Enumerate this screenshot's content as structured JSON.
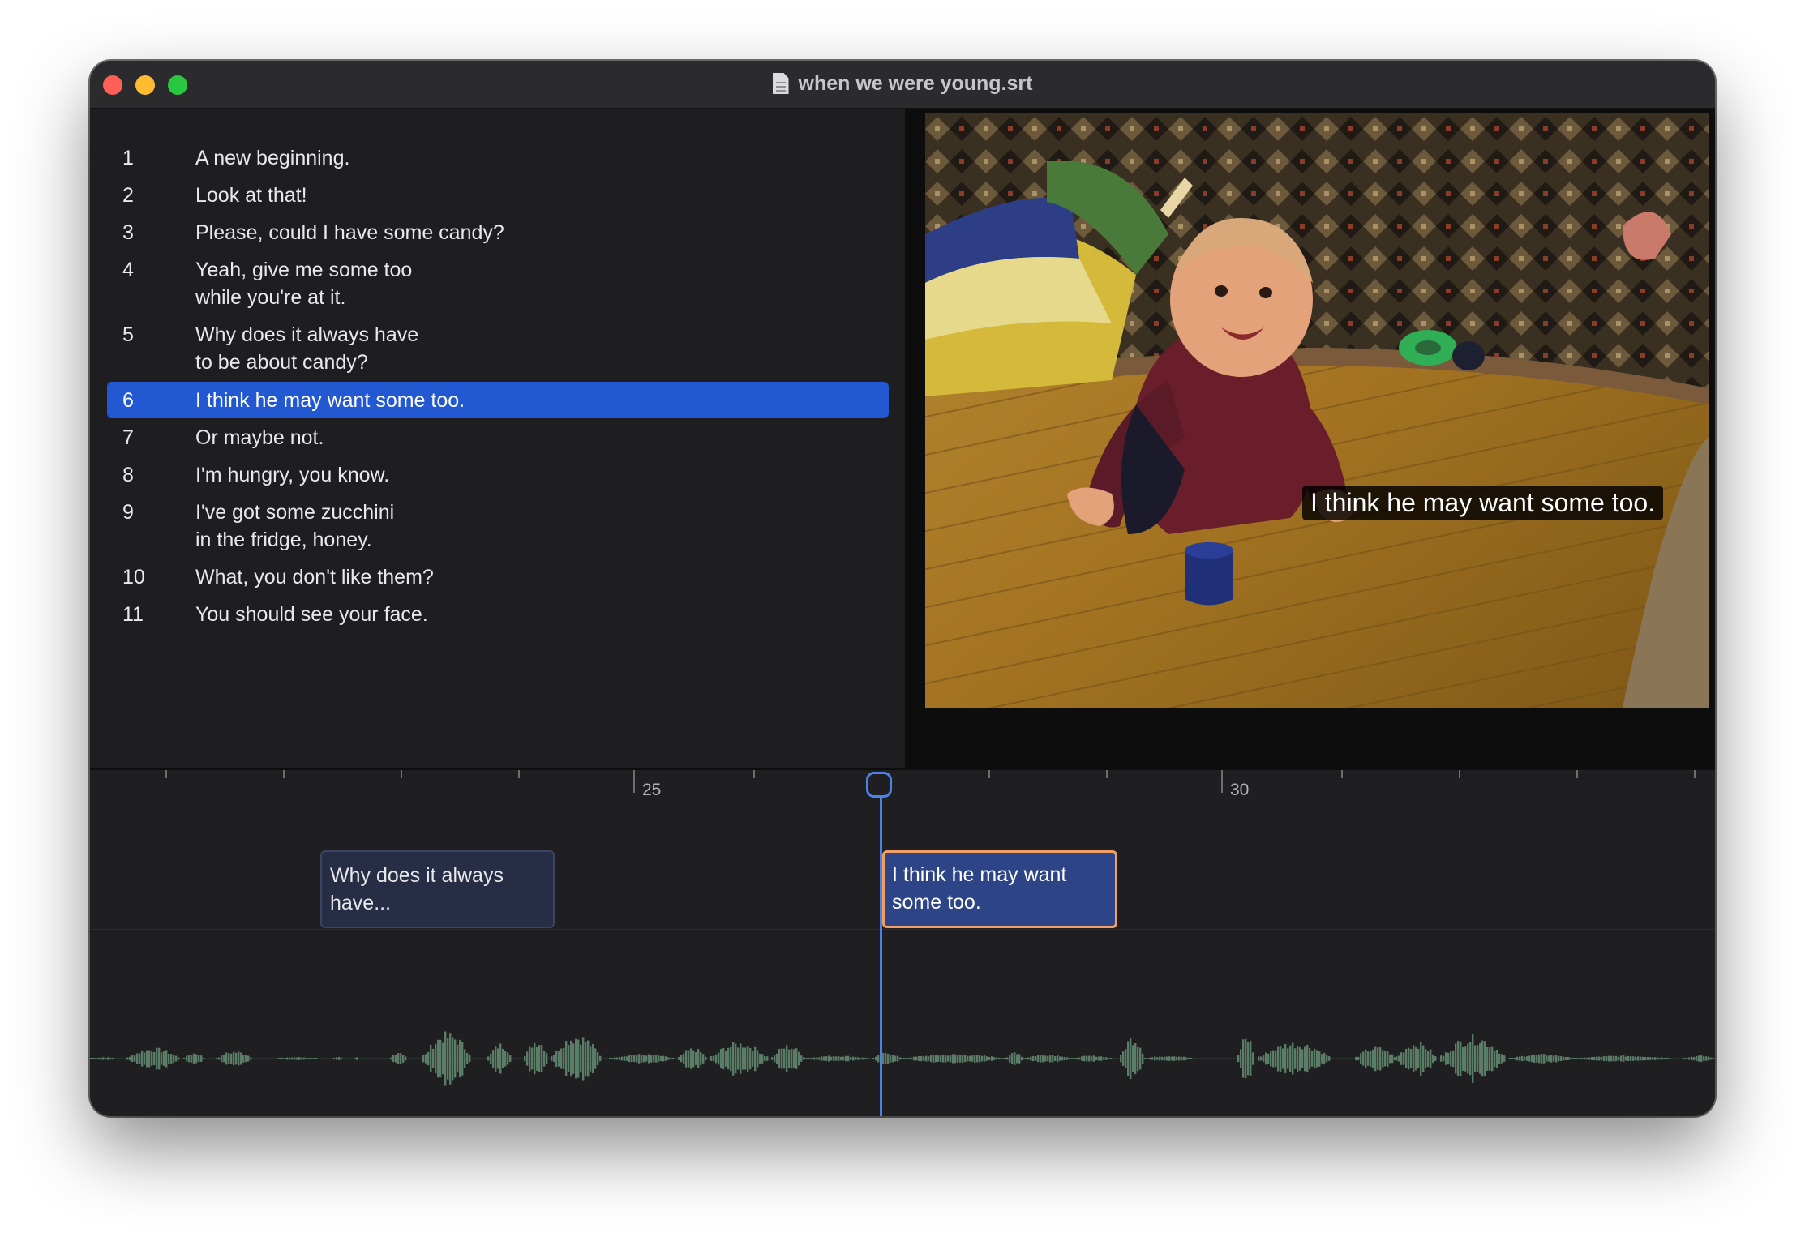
{
  "window": {
    "title": "when we were young.srt",
    "file_icon": "document-icon"
  },
  "subtitles": [
    {
      "num": "1",
      "text": "A new beginning."
    },
    {
      "num": "2",
      "text": "Look at that!"
    },
    {
      "num": "3",
      "text": "Please, could I have some candy?"
    },
    {
      "num": "4",
      "text": "Yeah, give me some too\nwhile you're at it."
    },
    {
      "num": "5",
      "text": "Why does it always have\nto be about candy?"
    },
    {
      "num": "6",
      "text": "I think he may want some too.",
      "selected": true
    },
    {
      "num": "7",
      "text": "Or maybe not."
    },
    {
      "num": "8",
      "text": "I'm hungry, you know."
    },
    {
      "num": "9",
      "text": "I've got some zucchini\nin the fridge, honey."
    },
    {
      "num": "10",
      "text": "What, you don't like them?"
    },
    {
      "num": "11",
      "text": "You should see your face."
    }
  ],
  "video": {
    "caption": "I think he may want some too."
  },
  "timeline": {
    "tick_labels": [
      "25",
      "30"
    ],
    "cues": {
      "previous": "Why does it always have...",
      "current": "I think he may want some too."
    }
  },
  "colors": {
    "selection": "#2258d1",
    "playhead": "#4c82e5",
    "active_cue_border": "#f0a066",
    "waveform": "#5b7d67"
  }
}
